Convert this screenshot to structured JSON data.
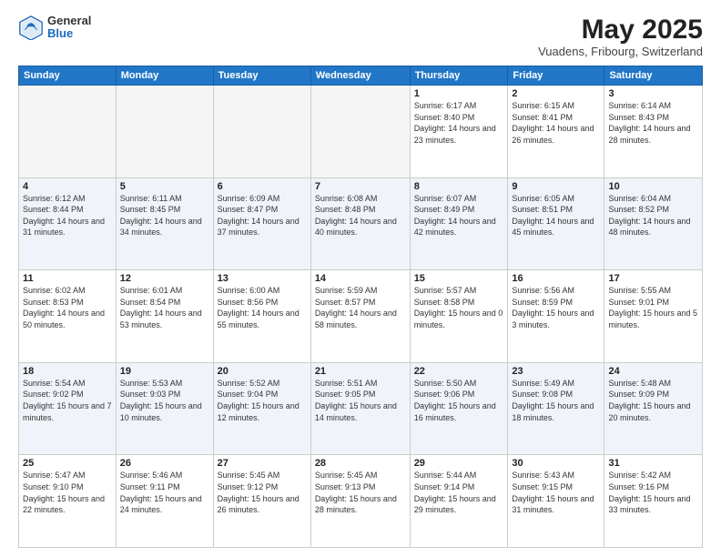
{
  "logo": {
    "general": "General",
    "blue": "Blue"
  },
  "header": {
    "month": "May 2025",
    "location": "Vuadens, Fribourg, Switzerland"
  },
  "weekdays": [
    "Sunday",
    "Monday",
    "Tuesday",
    "Wednesday",
    "Thursday",
    "Friday",
    "Saturday"
  ],
  "weeks": [
    [
      {
        "day": "",
        "info": ""
      },
      {
        "day": "",
        "info": ""
      },
      {
        "day": "",
        "info": ""
      },
      {
        "day": "",
        "info": ""
      },
      {
        "day": "1",
        "info": "Sunrise: 6:17 AM\nSunset: 8:40 PM\nDaylight: 14 hours\nand 23 minutes."
      },
      {
        "day": "2",
        "info": "Sunrise: 6:15 AM\nSunset: 8:41 PM\nDaylight: 14 hours\nand 26 minutes."
      },
      {
        "day": "3",
        "info": "Sunrise: 6:14 AM\nSunset: 8:43 PM\nDaylight: 14 hours\nand 28 minutes."
      }
    ],
    [
      {
        "day": "4",
        "info": "Sunrise: 6:12 AM\nSunset: 8:44 PM\nDaylight: 14 hours\nand 31 minutes."
      },
      {
        "day": "5",
        "info": "Sunrise: 6:11 AM\nSunset: 8:45 PM\nDaylight: 14 hours\nand 34 minutes."
      },
      {
        "day": "6",
        "info": "Sunrise: 6:09 AM\nSunset: 8:47 PM\nDaylight: 14 hours\nand 37 minutes."
      },
      {
        "day": "7",
        "info": "Sunrise: 6:08 AM\nSunset: 8:48 PM\nDaylight: 14 hours\nand 40 minutes."
      },
      {
        "day": "8",
        "info": "Sunrise: 6:07 AM\nSunset: 8:49 PM\nDaylight: 14 hours\nand 42 minutes."
      },
      {
        "day": "9",
        "info": "Sunrise: 6:05 AM\nSunset: 8:51 PM\nDaylight: 14 hours\nand 45 minutes."
      },
      {
        "day": "10",
        "info": "Sunrise: 6:04 AM\nSunset: 8:52 PM\nDaylight: 14 hours\nand 48 minutes."
      }
    ],
    [
      {
        "day": "11",
        "info": "Sunrise: 6:02 AM\nSunset: 8:53 PM\nDaylight: 14 hours\nand 50 minutes."
      },
      {
        "day": "12",
        "info": "Sunrise: 6:01 AM\nSunset: 8:54 PM\nDaylight: 14 hours\nand 53 minutes."
      },
      {
        "day": "13",
        "info": "Sunrise: 6:00 AM\nSunset: 8:56 PM\nDaylight: 14 hours\nand 55 minutes."
      },
      {
        "day": "14",
        "info": "Sunrise: 5:59 AM\nSunset: 8:57 PM\nDaylight: 14 hours\nand 58 minutes."
      },
      {
        "day": "15",
        "info": "Sunrise: 5:57 AM\nSunset: 8:58 PM\nDaylight: 15 hours\nand 0 minutes."
      },
      {
        "day": "16",
        "info": "Sunrise: 5:56 AM\nSunset: 8:59 PM\nDaylight: 15 hours\nand 3 minutes."
      },
      {
        "day": "17",
        "info": "Sunrise: 5:55 AM\nSunset: 9:01 PM\nDaylight: 15 hours\nand 5 minutes."
      }
    ],
    [
      {
        "day": "18",
        "info": "Sunrise: 5:54 AM\nSunset: 9:02 PM\nDaylight: 15 hours\nand 7 minutes."
      },
      {
        "day": "19",
        "info": "Sunrise: 5:53 AM\nSunset: 9:03 PM\nDaylight: 15 hours\nand 10 minutes."
      },
      {
        "day": "20",
        "info": "Sunrise: 5:52 AM\nSunset: 9:04 PM\nDaylight: 15 hours\nand 12 minutes."
      },
      {
        "day": "21",
        "info": "Sunrise: 5:51 AM\nSunset: 9:05 PM\nDaylight: 15 hours\nand 14 minutes."
      },
      {
        "day": "22",
        "info": "Sunrise: 5:50 AM\nSunset: 9:06 PM\nDaylight: 15 hours\nand 16 minutes."
      },
      {
        "day": "23",
        "info": "Sunrise: 5:49 AM\nSunset: 9:08 PM\nDaylight: 15 hours\nand 18 minutes."
      },
      {
        "day": "24",
        "info": "Sunrise: 5:48 AM\nSunset: 9:09 PM\nDaylight: 15 hours\nand 20 minutes."
      }
    ],
    [
      {
        "day": "25",
        "info": "Sunrise: 5:47 AM\nSunset: 9:10 PM\nDaylight: 15 hours\nand 22 minutes."
      },
      {
        "day": "26",
        "info": "Sunrise: 5:46 AM\nSunset: 9:11 PM\nDaylight: 15 hours\nand 24 minutes."
      },
      {
        "day": "27",
        "info": "Sunrise: 5:45 AM\nSunset: 9:12 PM\nDaylight: 15 hours\nand 26 minutes."
      },
      {
        "day": "28",
        "info": "Sunrise: 5:45 AM\nSunset: 9:13 PM\nDaylight: 15 hours\nand 28 minutes."
      },
      {
        "day": "29",
        "info": "Sunrise: 5:44 AM\nSunset: 9:14 PM\nDaylight: 15 hours\nand 29 minutes."
      },
      {
        "day": "30",
        "info": "Sunrise: 5:43 AM\nSunset: 9:15 PM\nDaylight: 15 hours\nand 31 minutes."
      },
      {
        "day": "31",
        "info": "Sunrise: 5:42 AM\nSunset: 9:16 PM\nDaylight: 15 hours\nand 33 minutes."
      }
    ]
  ]
}
